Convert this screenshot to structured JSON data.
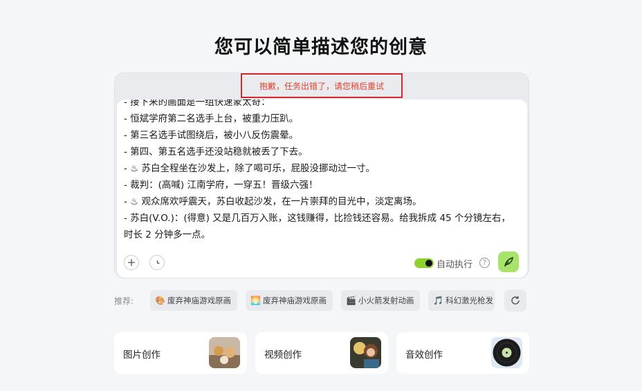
{
  "page": {
    "title": "您可以简单描述您的创意"
  },
  "error": {
    "message": "抱歉，任务出错了，请您稍后重试"
  },
  "editor": {
    "lines": [
      "- 接下来的画面是一组快速蒙太奇：",
      "- 恒斌学府第二名选手上台，被重力压趴。",
      "- 第三名选手试图绕后，被小八反伤震晕。",
      "- 第四、第五名选手还没站稳就被丢了下去。",
      "- ♨ 苏白全程坐在沙发上，除了喝可乐，屁股没挪动过一寸。",
      "- 裁判：(高喊) 江南学府，一穿五！晋级六强！",
      "- ♨ 观众席欢呼震天，苏白收起沙发，在一片崇拜的目光中，淡定离场。",
      "- 苏白(V.O.)：(得意) 又是几百万入账，这钱赚得，比捡钱还容易。给我拆成 45 个分镜左右，时长 2 分钟多一点。"
    ]
  },
  "toolbar": {
    "auto_exec_label": "自动执行",
    "auto_exec_on": true,
    "help_glyph": "?",
    "add_glyph": "+"
  },
  "suggestions": {
    "label": "推荐:",
    "chips": [
      {
        "emoji": "🎨",
        "text": "废弃神庙游戏原画"
      },
      {
        "emoji": "🌅",
        "text": "废弃神庙游戏原画"
      },
      {
        "emoji": "🎬",
        "text": "小火箭发射动画"
      },
      {
        "emoji": "🎵",
        "text": "科幻激光枪发"
      }
    ]
  },
  "cards": [
    {
      "label": "图片创作"
    },
    {
      "label": "视频创作"
    },
    {
      "label": "音效创作"
    }
  ],
  "colors": {
    "accent_green": "#a8e46b",
    "error_red": "#d9262b"
  }
}
